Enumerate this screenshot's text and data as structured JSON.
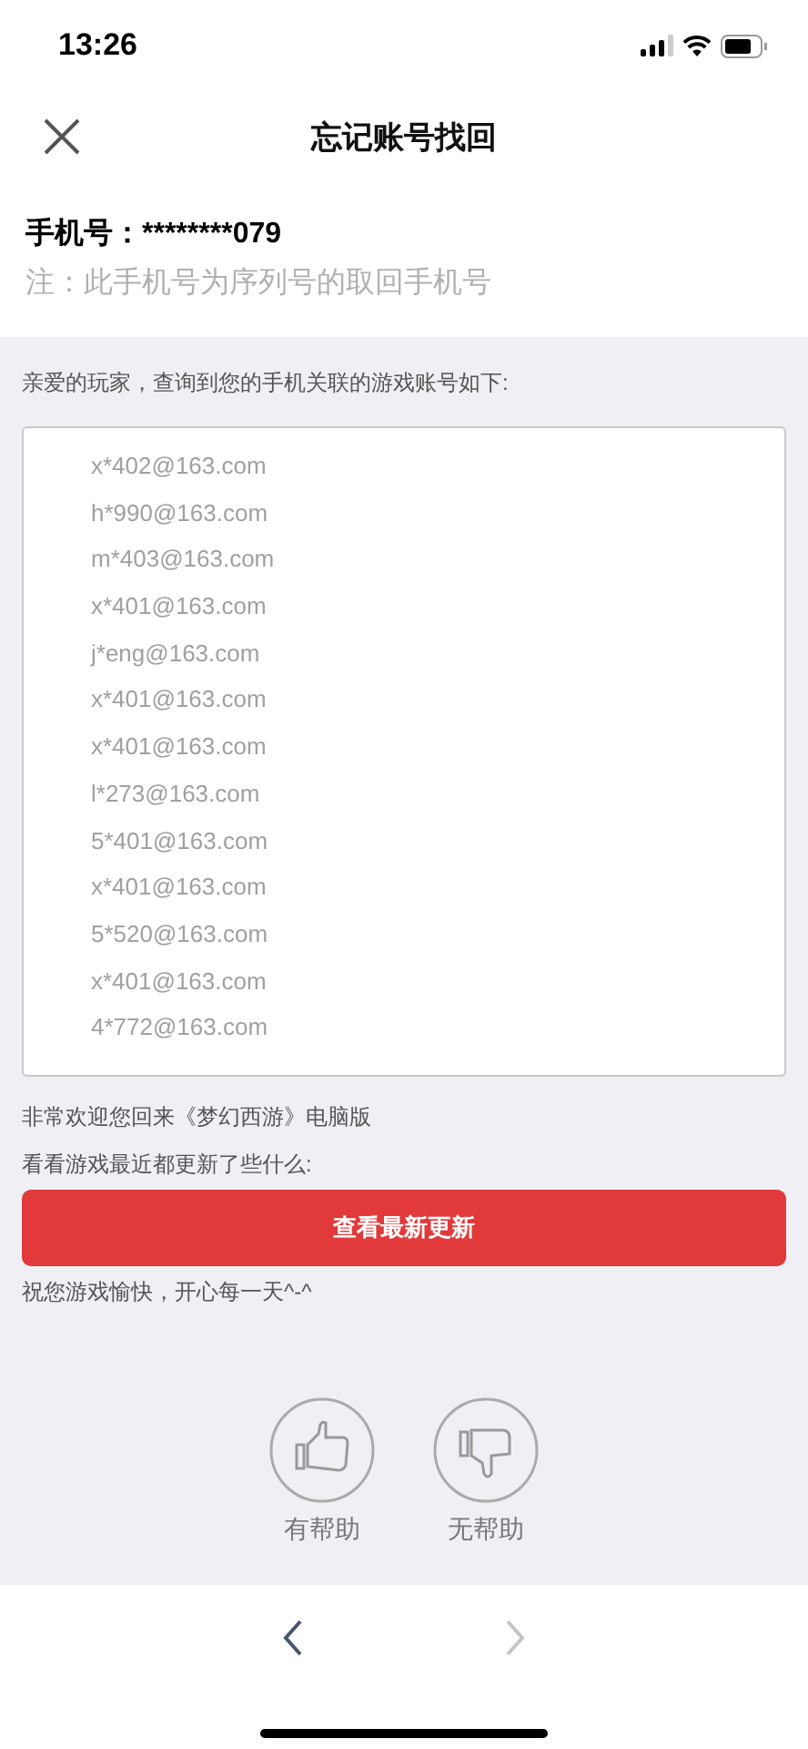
{
  "status_bar": {
    "time": "13:26"
  },
  "nav": {
    "title": "忘记账号找回"
  },
  "phone": {
    "label": "手机号：",
    "value": "********079",
    "note": "注：此手机号为序列号的取回手机号"
  },
  "intro": "亲爱的玩家，查询到您的手机关联的游戏账号如下:",
  "accounts": [
    "x*402@163.com",
    "h*990@163.com",
    "m*403@163.com",
    "x*401@163.com",
    "j*eng@163.com",
    "x*401@163.com",
    "x*401@163.com",
    "l*273@163.com",
    "5*401@163.com",
    "x*401@163.com",
    "5*520@163.com",
    "x*401@163.com",
    "4*772@163.com"
  ],
  "welcome": "非常欢迎您回来《梦幻西游》电脑版",
  "prompt": "看看游戏最近都更新了些什么:",
  "update_button": "查看最新更新",
  "closing": "祝您游戏愉快，开心每一天^-^",
  "feedback": [
    {
      "kind": "up",
      "label": "有帮助"
    },
    {
      "kind": "down",
      "label": "无帮助"
    }
  ],
  "toolbar": {
    "back_disabled": false,
    "forward_disabled": true
  }
}
